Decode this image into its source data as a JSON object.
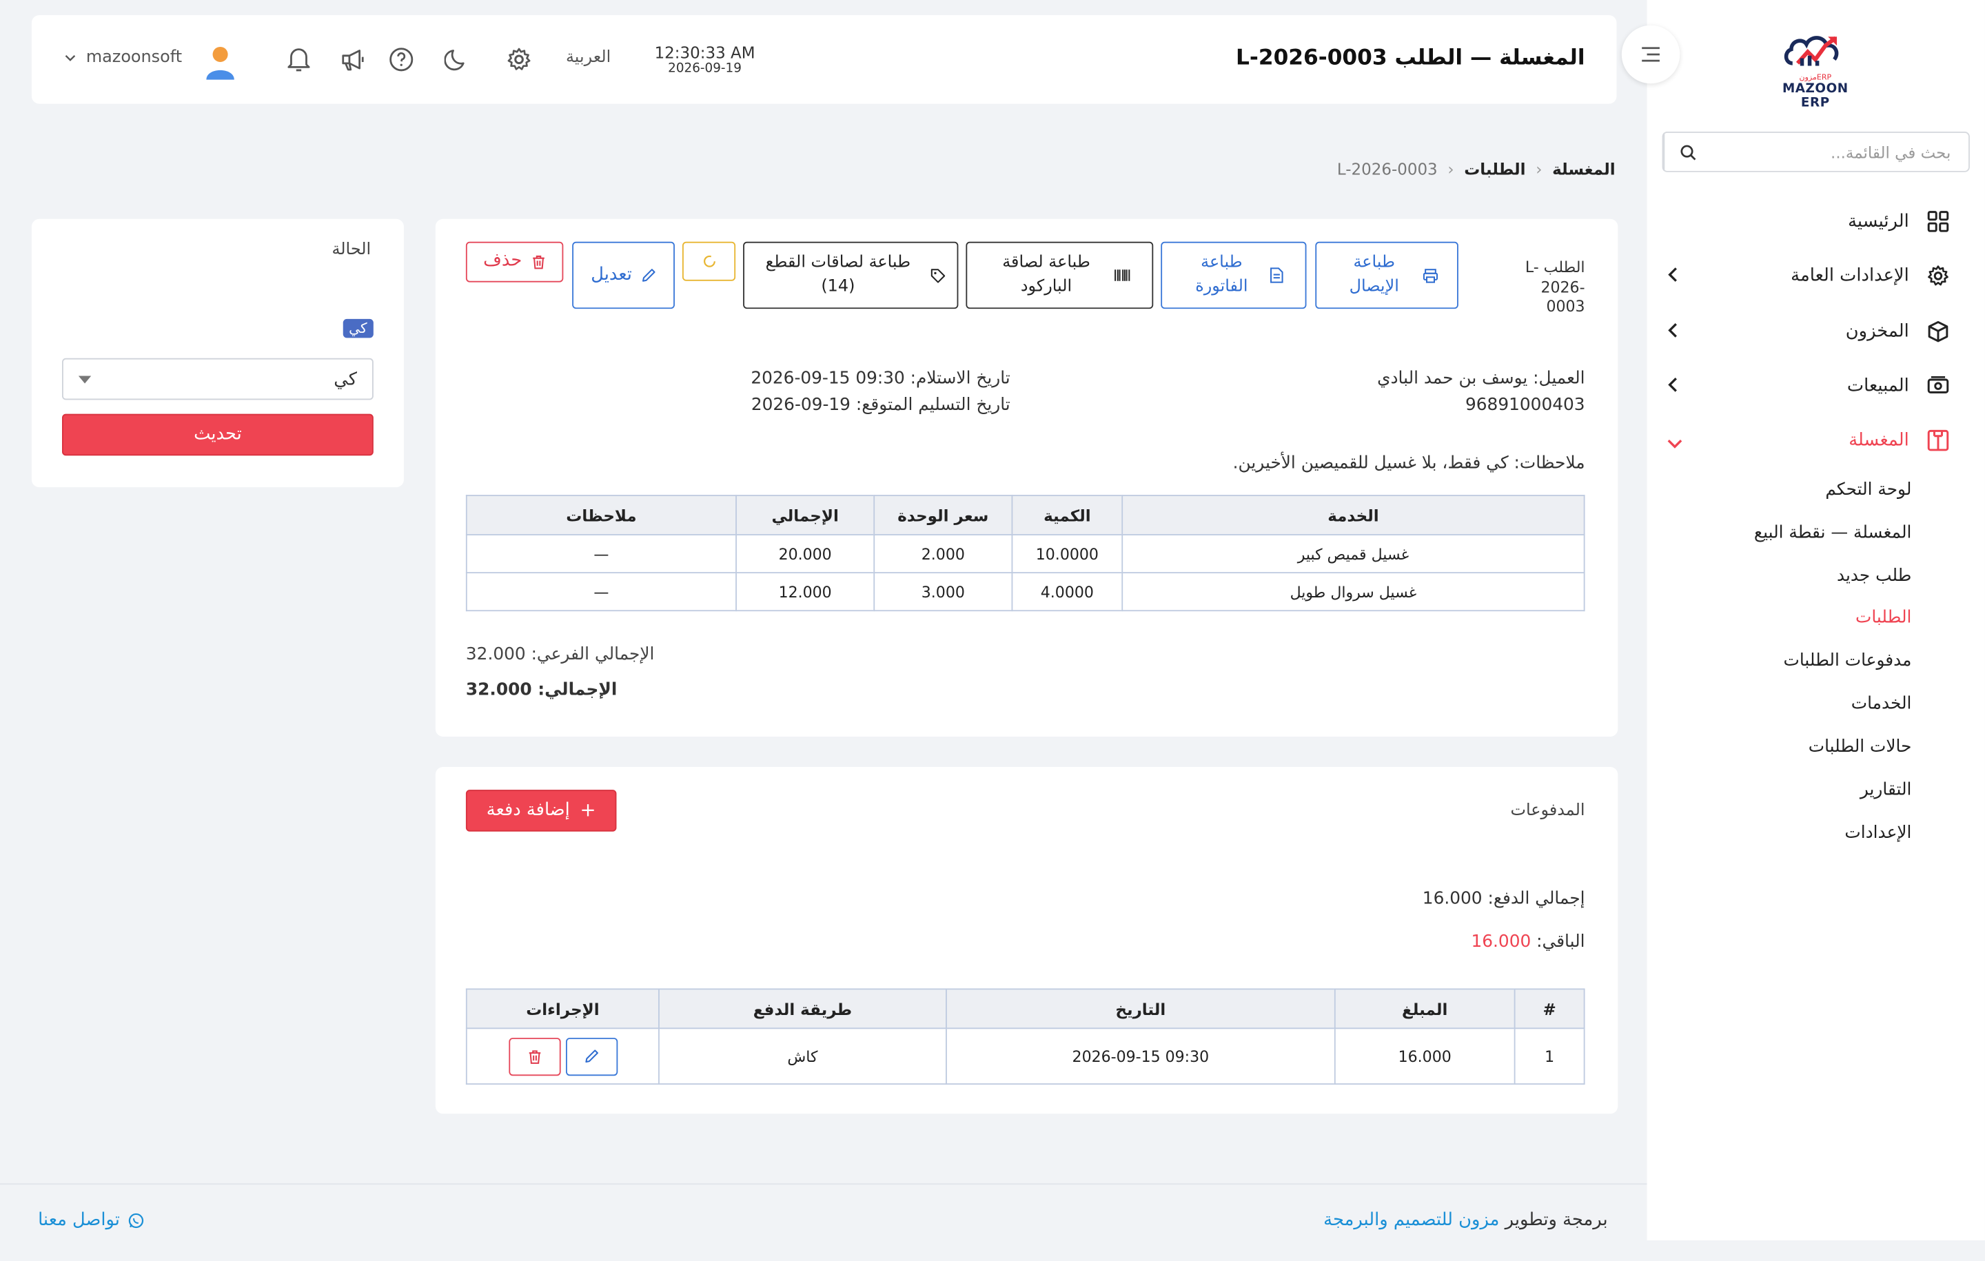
{
  "sidebar": {
    "logo_text": "MAZOON ERP",
    "logo_sub": "ERPمزون",
    "search_placeholder": "بحث في القائمة...",
    "items": [
      {
        "label": "الرئيسية",
        "icon": "grid-icon"
      },
      {
        "label": "الإعدادات العامة",
        "icon": "gear-icon"
      },
      {
        "label": "المخزون",
        "icon": "box-icon"
      },
      {
        "label": "المبيعات",
        "icon": "cash-icon"
      },
      {
        "label": "المغسلة",
        "icon": "laundry-icon"
      }
    ],
    "sub_items": [
      "لوحة التحكم",
      "المغسلة — نقطة البيع",
      "طلب جديد",
      "الطلبات",
      "مدفوعات الطلبات",
      "الخدمات",
      "حالات الطلبات",
      "التقارير",
      "الإعدادات"
    ],
    "accent": "#ef4452"
  },
  "header": {
    "title": "المغسلة — الطلب L-2026-0003",
    "time": "12:30:33 AM",
    "date": "2026-09-19",
    "language": "العربية",
    "username": "mazoonsoft"
  },
  "breadcrumb": {
    "root": "المغسلة",
    "section": "الطلبات",
    "current": "L-2026-0003"
  },
  "order": {
    "label": "الطلب L-2026-0003",
    "buttons": {
      "print_receipt": "طباعة الإيصال",
      "print_invoice": "طباعة الفاتورة",
      "print_barcode": "طباعة لصاقة الباركود",
      "print_piece_labels": "طباعة لصاقات القطع (14)",
      "edit": "تعديل",
      "delete": "حذف"
    },
    "customer_label": "العميل:",
    "customer_name": "يوسف بن حمد البادي",
    "customer_phone": "96891000403",
    "received_label": "تاريخ الاستلام:",
    "received_value": "2026-09-15 09:30",
    "expected_label": "تاريخ التسليم المتوقع:",
    "expected_value": "2026-09-19",
    "notes": "ملاحظات: كي فقط، بلا غسيل للقميصين الأخيرين.",
    "columns": [
      "الخدمة",
      "الكمية",
      "سعر الوحدة",
      "الإجمالي",
      "ملاحظات"
    ],
    "rows": [
      [
        "غسيل قميص كبير",
        "10.0000",
        "2.000",
        "20.000",
        "—"
      ],
      [
        "غسيل سروال طويل",
        "4.0000",
        "3.000",
        "12.000",
        "—"
      ]
    ],
    "subtotal_label": "الإجمالي الفرعي:",
    "subtotal_value": "32.000",
    "total_label": "الإجمالي:",
    "total_value": "32.000"
  },
  "payments": {
    "title": "المدفوعات",
    "add_button": "إضافة دفعة",
    "paid_label": "إجمالي الدفع:",
    "paid_value": "16.000",
    "remaining_label": "الباقي:",
    "remaining_value": "16.000",
    "columns": [
      "#",
      "المبلغ",
      "التاريخ",
      "طريقة الدفع",
      "الإجراءات"
    ],
    "rows": [
      [
        "1",
        "16.000",
        "2026-09-15 09:30",
        "كاش"
      ]
    ]
  },
  "status": {
    "title": "الحالة",
    "badge": "كي",
    "select_value": "كي",
    "update_button": "تحديث"
  },
  "footer": {
    "credit_prefix": "برمجة وتطوير",
    "credit_link": "مزون للتصميم والبرمجة",
    "contact": "تواصل معنا"
  }
}
